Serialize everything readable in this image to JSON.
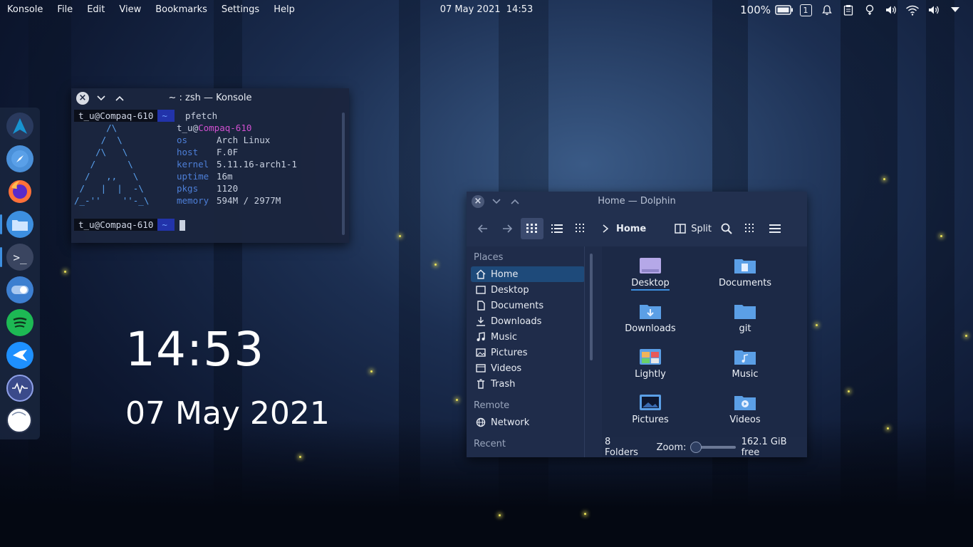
{
  "top_panel": {
    "app_name": "Konsole",
    "menus": [
      "File",
      "Edit",
      "View",
      "Bookmarks",
      "Settings",
      "Help"
    ],
    "clock": "07 May 2021  14:53",
    "battery": "100%",
    "notification_count": "1",
    "tray_icons": [
      "battery-icon",
      "notification-count-icon",
      "bell-icon",
      "clipboard-icon",
      "lightbulb-icon",
      "audio-icon",
      "wifi-icon",
      "volume-icon",
      "chevron-down-icon"
    ]
  },
  "dock": {
    "items": [
      {
        "name": "archlinux-icon",
        "color": "#1793d1"
      },
      {
        "name": "compass-icon",
        "color": "#4a90d9"
      },
      {
        "name": "firefox-icon",
        "color": "#ff7139"
      },
      {
        "name": "folder-icon",
        "color": "#3d8fe0"
      },
      {
        "name": "terminal-icon",
        "color": "#2d3748"
      },
      {
        "name": "toggle-icon",
        "color": "#3d7fd0"
      },
      {
        "name": "spotify-icon",
        "color": "#1db954"
      },
      {
        "name": "bird-icon",
        "color": "#1e90ff"
      },
      {
        "name": "waveform-icon",
        "color": "#3a4a8a"
      },
      {
        "name": "circle-icon",
        "color": "#ffffff"
      }
    ]
  },
  "konsole": {
    "title": "~ : zsh — Konsole",
    "prompt_user": "t_u@Compaq-610",
    "prompt_arrow": "~",
    "command": "pfetch",
    "ascii": [
      "      /\\",
      "     /  \\",
      "    /\\   \\",
      "   /      \\",
      "  /   ,,   \\",
      " /   |  |  -\\",
      "/_-''    ''-_\\"
    ],
    "info_user": "t_u",
    "info_host": "Compaq-610",
    "info": [
      {
        "key": "os",
        "value": "Arch Linux"
      },
      {
        "key": "host",
        "value": "F.0F"
      },
      {
        "key": "kernel",
        "value": "5.11.16-arch1-1"
      },
      {
        "key": "uptime",
        "value": "16m"
      },
      {
        "key": "pkgs",
        "value": "1120"
      },
      {
        "key": "memory",
        "value": "594M / 2977M"
      }
    ]
  },
  "desktop_clock": {
    "time": "14:53",
    "date": "07 May 2021"
  },
  "dolphin": {
    "title": "Home — Dolphin",
    "breadcrumb": "Home",
    "split_label": "Split",
    "places_heading": "Places",
    "places": [
      "Home",
      "Desktop",
      "Documents",
      "Downloads",
      "Music",
      "Pictures",
      "Videos",
      "Trash"
    ],
    "remote_heading": "Remote",
    "remote": [
      "Network"
    ],
    "recent_heading": "Recent",
    "files": [
      "Desktop",
      "Documents",
      "Downloads",
      "git",
      "Lightly",
      "Music",
      "Pictures",
      "Videos"
    ],
    "status_folders": "8 Folders",
    "zoom_label": "Zoom:",
    "free_space": "162.1 GiB free",
    "zoom_level": 0.1
  },
  "colors": {
    "accent": "#3d8fe0",
    "folder": "#5b9fe6"
  }
}
